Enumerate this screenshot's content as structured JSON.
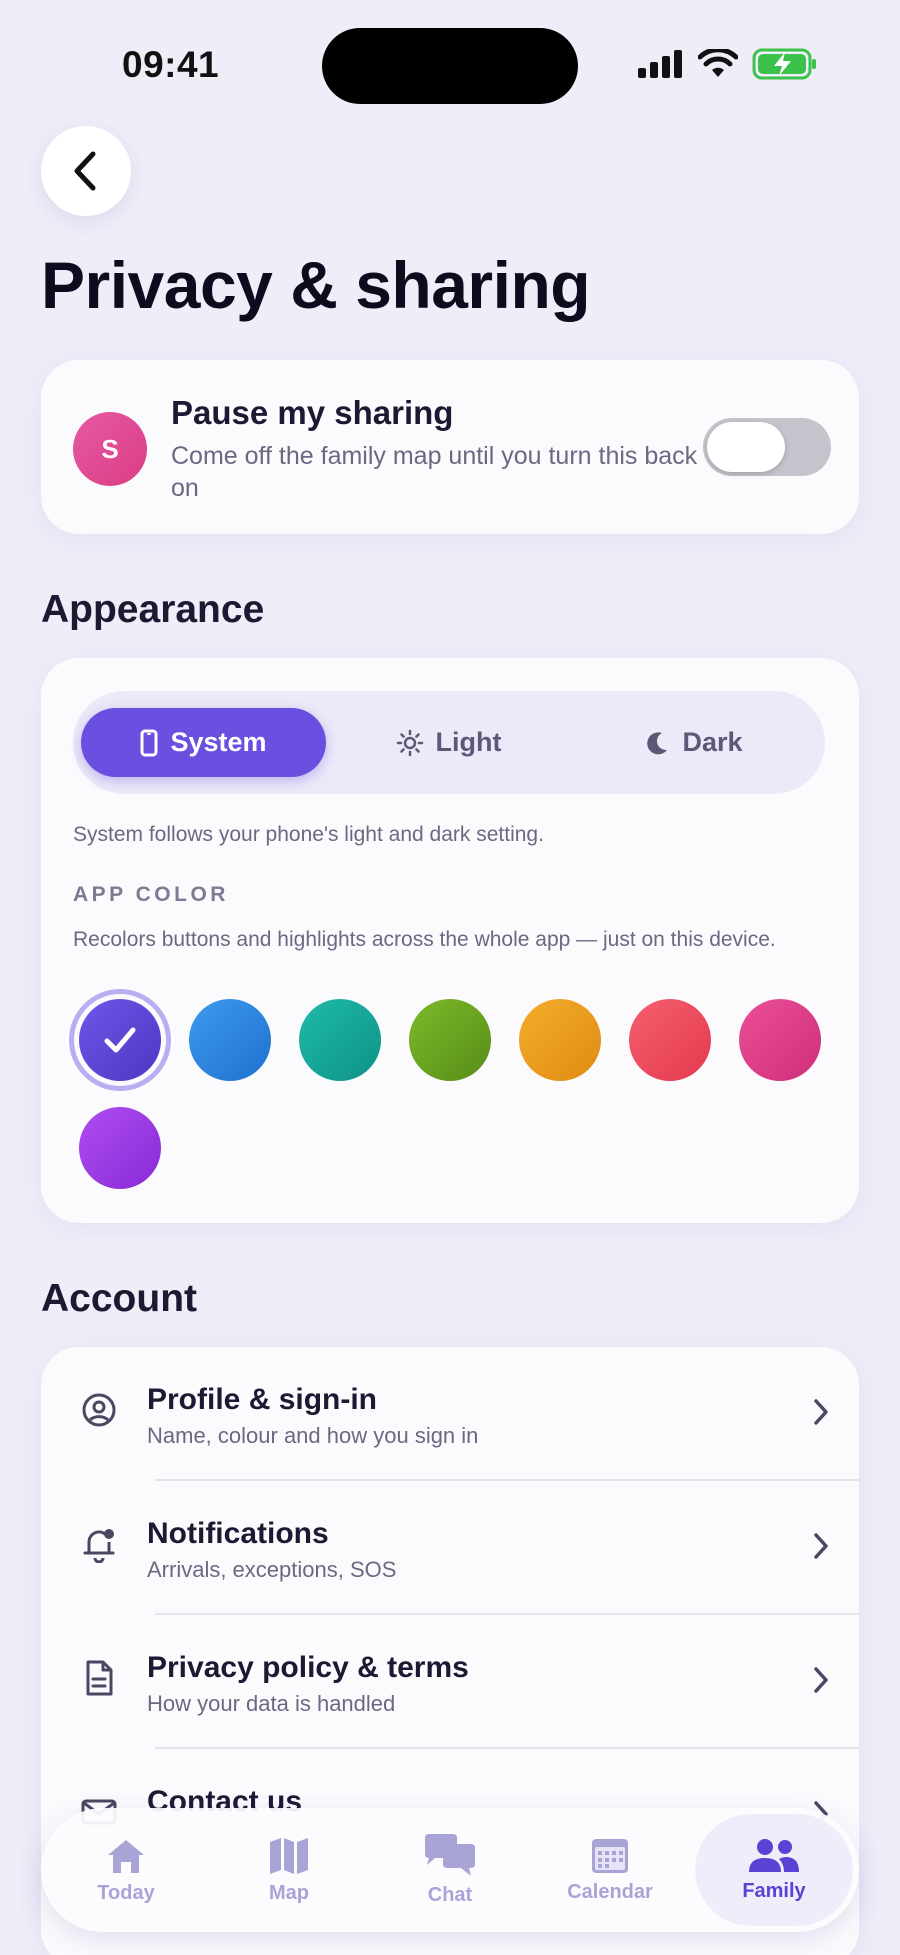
{
  "status_bar": {
    "time": "09:41"
  },
  "header": {
    "back_icon": "chevron-left-icon",
    "title": "Privacy & sharing"
  },
  "pause_sharing": {
    "avatar_initial": "S",
    "avatar_color": "#de4690",
    "title": "Pause my sharing",
    "subtitle": "Come off the family map until you turn this back on",
    "enabled": false
  },
  "appearance": {
    "section_title": "Appearance",
    "modes": [
      {
        "label": "System",
        "icon": "phone-icon",
        "selected": true
      },
      {
        "label": "Light",
        "icon": "sun-icon",
        "selected": false
      },
      {
        "label": "Dark",
        "icon": "moon-icon",
        "selected": false
      }
    ],
    "mode_note": "System follows your phone's light and dark setting.",
    "app_color_label": "APP COLOR",
    "app_color_desc": "Recolors buttons and highlights across the whole app — just on this device.",
    "colors": [
      {
        "name": "indigo",
        "hex": "#5b45d6",
        "selected": true
      },
      {
        "name": "blue",
        "hex": "#2b85e0",
        "selected": false
      },
      {
        "name": "teal",
        "hex": "#14a89a",
        "selected": false
      },
      {
        "name": "green",
        "hex": "#6aa320",
        "selected": false
      },
      {
        "name": "orange",
        "hex": "#eb9f1e",
        "selected": false
      },
      {
        "name": "red",
        "hex": "#ef4d5e",
        "selected": false
      },
      {
        "name": "pink",
        "hex": "#e0418a",
        "selected": false
      },
      {
        "name": "purple",
        "hex": "#9d3de6",
        "selected": false
      }
    ]
  },
  "account": {
    "section_title": "Account",
    "items": [
      {
        "title": "Profile & sign-in",
        "subtitle": "Name, colour and how you sign in",
        "icon": "user-circle-icon"
      },
      {
        "title": "Notifications",
        "subtitle": "Arrivals, exceptions, SOS",
        "icon": "bell-icon"
      },
      {
        "title": "Privacy policy & terms",
        "subtitle": "How your data is handled",
        "icon": "document-icon"
      },
      {
        "title": "Contact us",
        "subtitle": "",
        "icon": "mail-icon"
      }
    ]
  },
  "tab_bar": {
    "tabs": [
      {
        "label": "Today",
        "icon": "home-icon",
        "active": false
      },
      {
        "label": "Map",
        "icon": "map-icon",
        "active": false
      },
      {
        "label": "Chat",
        "icon": "chat-icon",
        "active": false
      },
      {
        "label": "Calendar",
        "icon": "calendar-icon",
        "active": false
      },
      {
        "label": "Family",
        "icon": "family-icon",
        "active": true
      }
    ]
  },
  "colors": {
    "accent": "#6a4fe0",
    "background": "#eeeef9",
    "tab_inactive": "#a9a4d6",
    "tab_active": "#5a43d4"
  }
}
